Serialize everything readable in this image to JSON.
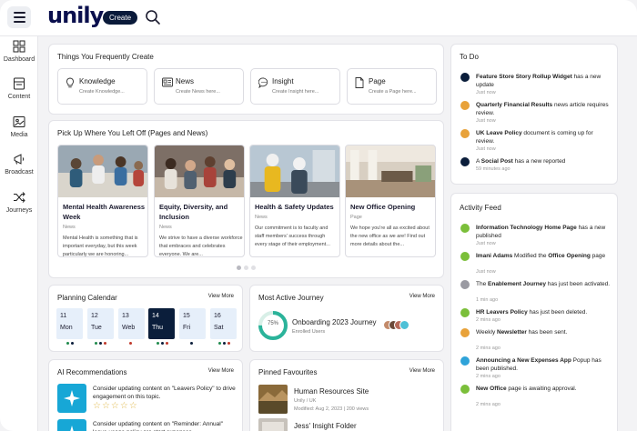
{
  "header": {
    "logo": "unily",
    "create_label": "Create"
  },
  "sidebar": {
    "items": [
      {
        "label": "Dashboard",
        "icon": "grid-icon"
      },
      {
        "label": "Content",
        "icon": "document-icon"
      },
      {
        "label": "Media",
        "icon": "image-icon"
      },
      {
        "label": "Broadcast",
        "icon": "megaphone-icon"
      },
      {
        "label": "Journeys",
        "icon": "shuffle-icon"
      }
    ]
  },
  "create": {
    "title": "Things You Frequently Create",
    "items": [
      {
        "label": "Knowledge",
        "sub": "Create Knowledge...",
        "icon": "lightbulb-icon"
      },
      {
        "label": "News",
        "sub": "Create News here...",
        "icon": "news-icon"
      },
      {
        "label": "Insight",
        "sub": "Create Insight here...",
        "icon": "chat-icon"
      },
      {
        "label": "Page",
        "sub": "Create a Page here...",
        "icon": "page-icon"
      }
    ]
  },
  "pages": {
    "title": "Pick Up Where You Left Off (Pages and News)",
    "items": [
      {
        "title": "Mental Health Awareness Week",
        "kind": "News",
        "desc": "Mental Health is something that is important everyday, but this week particularly we are honoring..."
      },
      {
        "title": "Equity, Diversity, and Inclusion",
        "kind": "News",
        "desc": "We strive to have a diverse workforce that embraces and celebrates everyone. We are..."
      },
      {
        "title": "Health & Safety Updates",
        "kind": "News",
        "desc": "Our commitment is to faculty and staff members' success through every stage of their employment..."
      },
      {
        "title": "New Office Opening",
        "kind": "Page",
        "desc": "We hope you're all as excited about the new office as we are! Find out more details about the..."
      }
    ]
  },
  "calendar": {
    "title": "Planning Calendar",
    "view_more": "View More",
    "days": [
      {
        "num": "11",
        "name": "Mon"
      },
      {
        "num": "12",
        "name": "Tue"
      },
      {
        "num": "13",
        "name": "Web"
      },
      {
        "num": "14",
        "name": "Thu"
      },
      {
        "num": "15",
        "name": "Fri"
      },
      {
        "num": "16",
        "name": "Sat"
      }
    ],
    "selected_index": 3
  },
  "journey": {
    "title": "Most Active Journey",
    "view_more": "View More",
    "percent": "75%",
    "progress": 0.75,
    "name": "Onboarding 2023 Journey",
    "status": "Enrolled Users"
  },
  "ai": {
    "title": "AI Recommendations",
    "view_more": "View More",
    "items": [
      {
        "text": "Consider updating content on \"Leavers Policy\" to drive engagement on this topic.",
        "stars": "☆☆☆☆☆"
      },
      {
        "text": "Consider updating content on \"Reminder: Annual\" leave usage policy are start expenses..."
      }
    ]
  },
  "favourites": {
    "title": "Pinned Favourites",
    "view_more": "View More",
    "items": [
      {
        "name": "Human Resources Site",
        "sub1": "Unily / UK",
        "sub2": "Modified: Aug 2, 2023 | 200 views"
      },
      {
        "name": "Jess' Insight Folder"
      }
    ]
  },
  "todo": {
    "title": "To Do",
    "items": [
      {
        "bold": "Feature Store Story Rollup Widget",
        "rest": " has a new update",
        "time": "Just now",
        "color": "#0b1e3b"
      },
      {
        "bold": "Quarterly Financial Results",
        "rest": " news article requires review.",
        "time": "Just now",
        "color": "#e8a23a"
      },
      {
        "bold": "UK Leave Policy",
        "rest": " document is coming up for review.",
        "time": "Just now",
        "color": "#e8a23a"
      },
      {
        "pre": "A ",
        "bold": "Social Post",
        "rest": " has a new reported",
        "time": "59 minutes ago",
        "color": "#0b1e3b"
      }
    ]
  },
  "feed": {
    "title": "Activity Feed",
    "items": [
      {
        "bold": "Information Technology Home Page",
        "rest": " has a new published",
        "time": "Just now",
        "color": "#7bbf3a"
      },
      {
        "bold": "Imani Adams",
        "rest": " Modified the ",
        "bold2": "Office Opening",
        "rest2": " page",
        "time": "Just now",
        "color": "#7bbf3a"
      },
      {
        "pre": "The ",
        "bold": "Enablement Journey",
        "rest": " has just been activated.",
        "time": "1 min ago",
        "color": "#9a9aa2"
      },
      {
        "bold": "HR Leavers Policy",
        "rest": " has just been deleted.",
        "time": "2 mins ago",
        "color": "#7bbf3a"
      },
      {
        "pre": "Weekly ",
        "bold": "Newsletter",
        "rest": " has been sent.",
        "time": "2 mins ago",
        "color": "#e8a23a"
      },
      {
        "bold": "Announcing a New Expenses App",
        "rest": " Popup has been published.",
        "time": "2 mins ago",
        "color": "#2fa3d9"
      },
      {
        "bold": "New Office",
        "rest": " page is awaiting approval.",
        "time": "2 mins ago",
        "color": "#7bbf3a"
      }
    ]
  }
}
